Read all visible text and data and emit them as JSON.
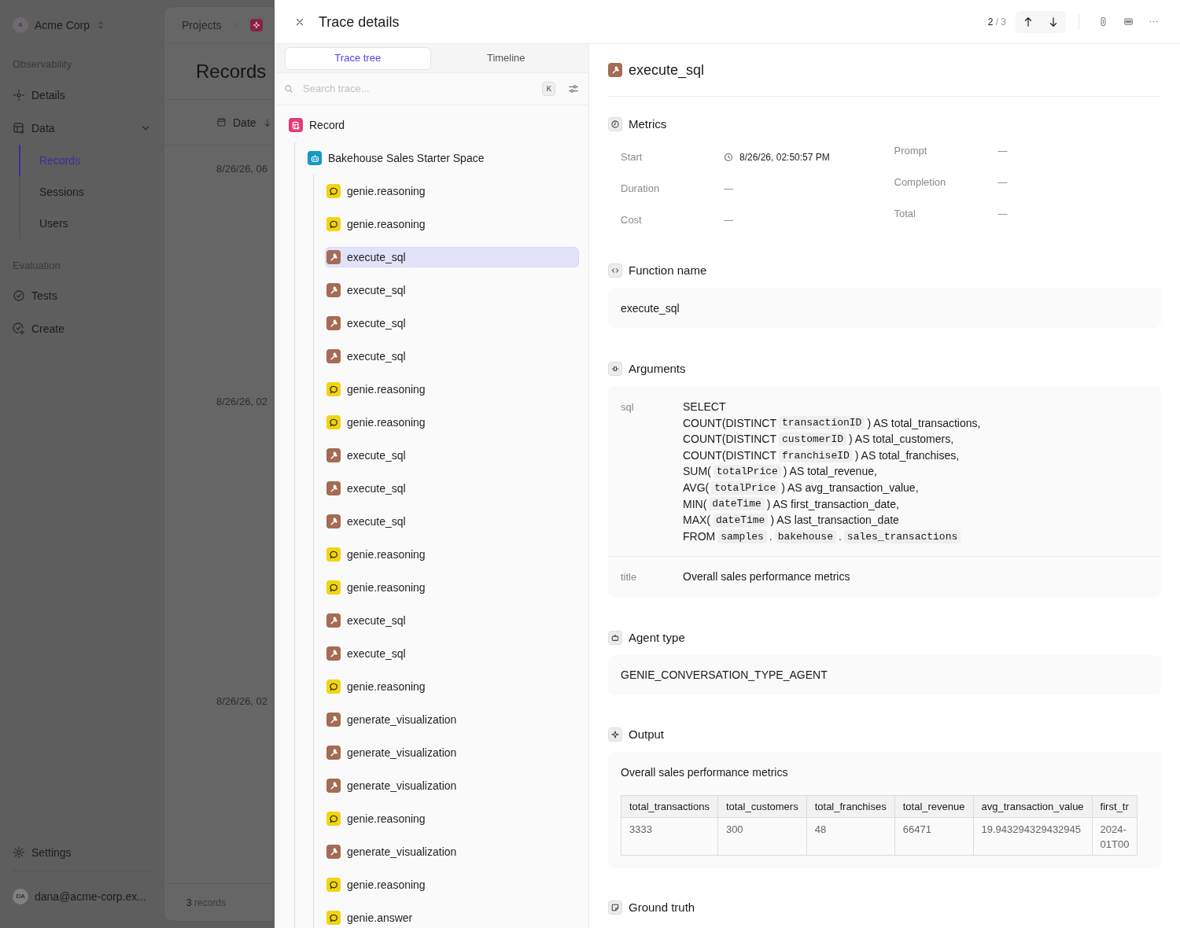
{
  "sidebar": {
    "org": {
      "initial": "A",
      "name": "Acme Corp"
    },
    "sections": [
      {
        "heading": "Observability",
        "items": [
          {
            "label": "Details",
            "kind": "details",
            "expanded": false
          },
          {
            "label": "Data",
            "kind": "data",
            "expanded": true,
            "children": [
              {
                "label": "Records",
                "selected": true
              },
              {
                "label": "Sessions",
                "selected": false
              },
              {
                "label": "Users",
                "selected": false
              }
            ]
          }
        ]
      },
      {
        "heading": "Evaluation",
        "items": [
          {
            "label": "Tests",
            "kind": "tests",
            "expanded": false
          },
          {
            "label": "Create",
            "kind": "create",
            "expanded": false
          }
        ]
      }
    ],
    "settings": "Settings",
    "user": {
      "initials": "DA",
      "email": "dana@acme-corp.ex..."
    }
  },
  "main": {
    "breadcrumb": "Projects",
    "title": "Records",
    "column": "Date",
    "dates": [
      "8/26/26, 06",
      "8/26/26, 02",
      "8/26/26, 02"
    ],
    "footer": {
      "count": "3",
      "label": "records"
    }
  },
  "drawer": {
    "title": "Trace details",
    "counter": {
      "current": "2",
      "rest": "/ 3"
    },
    "tabs": [
      {
        "label": "Trace tree",
        "selected": true
      },
      {
        "label": "Timeline",
        "selected": false
      }
    ],
    "search": {
      "placeholder": "Search trace...",
      "shortcut": "K"
    },
    "tree": [
      {
        "label": "Record",
        "kind": "record",
        "selected": false,
        "children": [
          {
            "label": "Bakehouse Sales Starter Space",
            "kind": "agent",
            "selected": false,
            "children": [
              {
                "label": "genie.reasoning",
                "kind": "reasoning",
                "selected": false
              },
              {
                "label": "genie.reasoning",
                "kind": "reasoning",
                "selected": false
              },
              {
                "label": "execute_sql",
                "kind": "tool",
                "selected": true
              },
              {
                "label": "execute_sql",
                "kind": "tool",
                "selected": false
              },
              {
                "label": "execute_sql",
                "kind": "tool",
                "selected": false
              },
              {
                "label": "execute_sql",
                "kind": "tool",
                "selected": false
              },
              {
                "label": "genie.reasoning",
                "kind": "reasoning",
                "selected": false
              },
              {
                "label": "genie.reasoning",
                "kind": "reasoning",
                "selected": false
              },
              {
                "label": "execute_sql",
                "kind": "tool",
                "selected": false
              },
              {
                "label": "execute_sql",
                "kind": "tool",
                "selected": false
              },
              {
                "label": "execute_sql",
                "kind": "tool",
                "selected": false
              },
              {
                "label": "genie.reasoning",
                "kind": "reasoning",
                "selected": false
              },
              {
                "label": "genie.reasoning",
                "kind": "reasoning",
                "selected": false
              },
              {
                "label": "execute_sql",
                "kind": "tool",
                "selected": false
              },
              {
                "label": "execute_sql",
                "kind": "tool",
                "selected": false
              },
              {
                "label": "genie.reasoning",
                "kind": "reasoning",
                "selected": false
              },
              {
                "label": "generate_visualization",
                "kind": "tool",
                "selected": false
              },
              {
                "label": "generate_visualization",
                "kind": "tool",
                "selected": false
              },
              {
                "label": "generate_visualization",
                "kind": "tool",
                "selected": false
              },
              {
                "label": "genie.reasoning",
                "kind": "reasoning",
                "selected": false
              },
              {
                "label": "generate_visualization",
                "kind": "tool",
                "selected": false
              },
              {
                "label": "genie.reasoning",
                "kind": "reasoning",
                "selected": false
              },
              {
                "label": "genie.answer",
                "kind": "answer",
                "selected": false
              }
            ]
          }
        ]
      }
    ],
    "detail": {
      "title": "execute_sql",
      "sections": [
        {
          "kind": "metrics",
          "title": "Metrics",
          "left": [
            {
              "label": "Start",
              "value": "8/26/26, 02:50:57 PM",
              "kind": "timestamp"
            },
            {
              "label": "Duration",
              "value": "—",
              "kind": "plain"
            },
            {
              "label": "Cost",
              "value": "—",
              "kind": "plain"
            }
          ],
          "right": [
            {
              "label": "Prompt",
              "value": "—"
            },
            {
              "label": "Completion",
              "value": "—"
            },
            {
              "label": "Total",
              "value": "—"
            }
          ]
        },
        {
          "kind": "function",
          "title": "Function name",
          "value": "execute_sql"
        },
        {
          "kind": "arguments",
          "title": "Arguments",
          "args": [
            {
              "name": "sql",
              "lines": [
                [
                  {
                    "kind": "text",
                    "text": "SELECT"
                  }
                ],
                [
                  {
                    "kind": "text",
                    "text": "COUNT(DISTINCT"
                  },
                  {
                    "kind": "code",
                    "text": "transactionID"
                  },
                  {
                    "kind": "text",
                    "text": ") AS total_transactions,"
                  }
                ],
                [
                  {
                    "kind": "text",
                    "text": "COUNT(DISTINCT"
                  },
                  {
                    "kind": "code",
                    "text": "customerID"
                  },
                  {
                    "kind": "text",
                    "text": ") AS total_customers,"
                  }
                ],
                [
                  {
                    "kind": "text",
                    "text": "COUNT(DISTINCT"
                  },
                  {
                    "kind": "code",
                    "text": "franchiseID"
                  },
                  {
                    "kind": "text",
                    "text": ") AS total_franchises,"
                  }
                ],
                [
                  {
                    "kind": "text",
                    "text": "SUM("
                  },
                  {
                    "kind": "code",
                    "text": "totalPrice"
                  },
                  {
                    "kind": "text",
                    "text": ") AS total_revenue,"
                  }
                ],
                [
                  {
                    "kind": "text",
                    "text": "AVG("
                  },
                  {
                    "kind": "code",
                    "text": "totalPrice"
                  },
                  {
                    "kind": "text",
                    "text": ") AS avg_transaction_value,"
                  }
                ],
                [
                  {
                    "kind": "text",
                    "text": "MIN("
                  },
                  {
                    "kind": "code",
                    "text": "dateTime"
                  },
                  {
                    "kind": "text",
                    "text": ") AS first_transaction_date,"
                  }
                ],
                [
                  {
                    "kind": "text",
                    "text": "MAX("
                  },
                  {
                    "kind": "code",
                    "text": "dateTime"
                  },
                  {
                    "kind": "text",
                    "text": ") AS last_transaction_date"
                  }
                ],
                [
                  {
                    "kind": "text",
                    "text": "FROM"
                  },
                  {
                    "kind": "code",
                    "text": "samples"
                  },
                  {
                    "kind": "text",
                    "text": "."
                  },
                  {
                    "kind": "code",
                    "text": "bakehouse"
                  },
                  {
                    "kind": "text",
                    "text": "."
                  },
                  {
                    "kind": "code",
                    "text": "sales_transactions"
                  }
                ]
              ]
            },
            {
              "name": "title",
              "lines": [
                [
                  {
                    "kind": "text",
                    "text": "Overall sales performance metrics"
                  }
                ]
              ]
            }
          ]
        },
        {
          "kind": "agent",
          "title": "Agent type",
          "value": "GENIE_CONVERSATION_TYPE_AGENT"
        },
        {
          "kind": "output",
          "title": "Output",
          "caption": "Overall sales performance metrics",
          "table": {
            "columns": [
              "total_transactions",
              "total_customers",
              "total_franchises",
              "total_revenue",
              "avg_transaction_value",
              "first_tr"
            ],
            "rows": [
              [
                "3333",
                "300",
                "48",
                "66471",
                "19.943294329432945",
                "2024-\n01T00"
              ]
            ]
          }
        },
        {
          "kind": "ground_truth",
          "title": "Ground truth"
        }
      ]
    }
  }
}
